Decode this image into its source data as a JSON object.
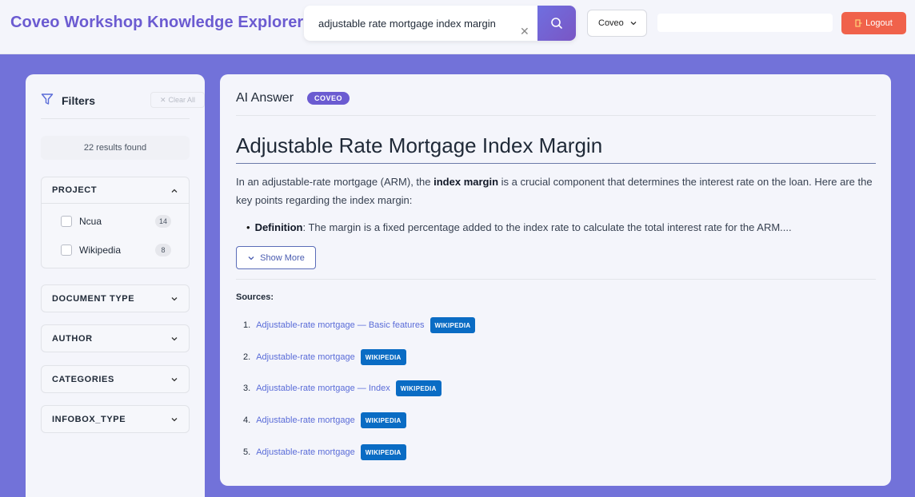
{
  "header": {
    "app_title": "Coveo Workshop Knowledge Explorer",
    "search_value": "adjustable rate mortgage index margin",
    "org_select": "Coveo",
    "logout_label": "Logout"
  },
  "sidebar": {
    "title": "Filters",
    "clear_all": "Clear All",
    "results_found": "22 results found",
    "facets": [
      {
        "label": "PROJECT",
        "expanded": true,
        "values": [
          {
            "label": "Ncua",
            "count": "14"
          },
          {
            "label": "Wikipedia",
            "count": "8"
          }
        ]
      },
      {
        "label": "DOCUMENT TYPE",
        "expanded": false
      },
      {
        "label": "AUTHOR",
        "expanded": false
      },
      {
        "label": "CATEGORIES",
        "expanded": false
      },
      {
        "label": "INFOBOX_TYPE",
        "expanded": false
      }
    ]
  },
  "main": {
    "ai_title": "AI Answer",
    "ai_badge": "COVEO",
    "answer_title": "Adjustable Rate Mortgage Index Margin",
    "para_part1": "In an adjustable-rate mortgage (ARM), the ",
    "para_bold": "index margin",
    "para_part2": " is a crucial component that determines the interest rate on the loan. Here are the key points regarding the index margin:",
    "bullet_bold": "Definition",
    "bullet_text": ": The margin is a fixed percentage added to the index rate to calculate the total interest rate for the ARM....",
    "show_more": "Show More",
    "sources_label": "Sources:",
    "sources": [
      {
        "num": "1.",
        "title": "Adjustable-rate mortgage — Basic features",
        "badge": "WIKIPEDIA"
      },
      {
        "num": "2.",
        "title": "Adjustable-rate mortgage",
        "badge": "WIKIPEDIA"
      },
      {
        "num": "3.",
        "title": "Adjustable-rate mortgage — Index",
        "badge": "WIKIPEDIA"
      },
      {
        "num": "4.",
        "title": "Adjustable-rate mortgage",
        "badge": "WIKIPEDIA"
      },
      {
        "num": "5.",
        "title": "Adjustable-rate mortgage",
        "badge": "WIKIPEDIA"
      }
    ]
  },
  "colors": {
    "brand": "#6b5bd1",
    "background": "#7272d9",
    "logout": "#f0624b",
    "source_badge": "#0a6cc4"
  },
  "icons": [
    "search-icon",
    "clear-search-icon",
    "chevron-down-icon",
    "logout-icon",
    "filter-icon",
    "close-icon",
    "chevron-up-icon"
  ]
}
